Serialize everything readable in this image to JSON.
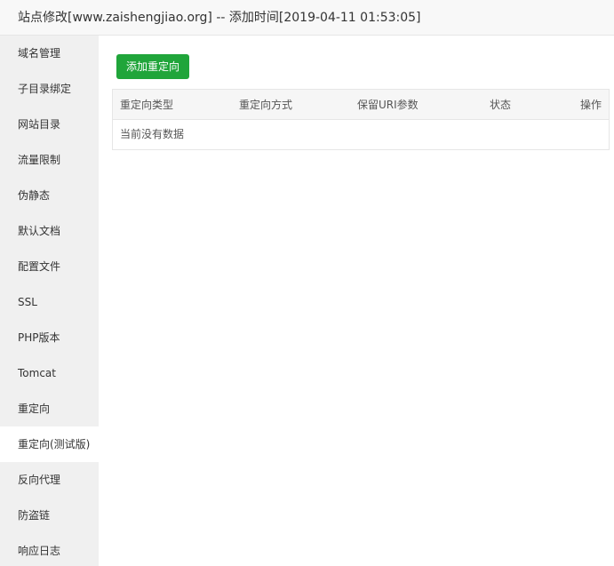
{
  "dialog": {
    "title": "站点修改[www.zaishengjiao.org] -- 添加时间[2019-04-11 01:53:05]"
  },
  "sidebar": {
    "items": [
      {
        "label": "域名管理"
      },
      {
        "label": "子目录绑定"
      },
      {
        "label": "网站目录"
      },
      {
        "label": "流量限制"
      },
      {
        "label": "伪静态"
      },
      {
        "label": "默认文档"
      },
      {
        "label": "配置文件"
      },
      {
        "label": "SSL"
      },
      {
        "label": "PHP版本"
      },
      {
        "label": "Tomcat"
      },
      {
        "label": "重定向"
      },
      {
        "label": "重定向(测试版)"
      },
      {
        "label": "反向代理"
      },
      {
        "label": "防盗链"
      },
      {
        "label": "响应日志"
      }
    ],
    "active_label": "重定向(测试版)"
  },
  "main": {
    "add_button_label": "添加重定向",
    "table": {
      "columns": [
        "重定向类型",
        "重定向方式",
        "保留URI参数",
        "状态",
        "操作"
      ],
      "empty_text": "当前没有数据"
    }
  },
  "colors": {
    "accent": "#20a53a",
    "sidebar_bg": "#f0f0f0",
    "header_bg": "#f6f6f6"
  }
}
